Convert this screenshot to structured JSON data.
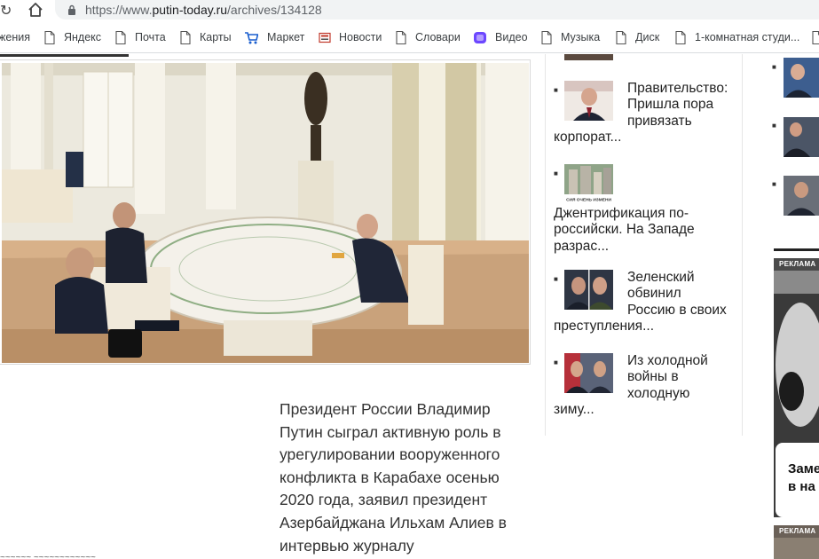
{
  "browser": {
    "url_prefix": "https://www.",
    "url_host": "putin-today.ru",
    "url_path": "/archives/134128",
    "bookmarks": [
      {
        "label": "жения",
        "icon": "none"
      },
      {
        "label": "Яндекс",
        "icon": "page-icon"
      },
      {
        "label": "Почта",
        "icon": "page-icon"
      },
      {
        "label": "Карты",
        "icon": "page-icon"
      },
      {
        "label": "Маркет",
        "icon": "cart-icon"
      },
      {
        "label": "Новости",
        "icon": "news-icon"
      },
      {
        "label": "Словари",
        "icon": "page-icon"
      },
      {
        "label": "Видео",
        "icon": "video-icon"
      },
      {
        "label": "Музыка",
        "icon": "page-icon"
      },
      {
        "label": "Диск",
        "icon": "page-icon"
      },
      {
        "label": "1-комнатная студи...",
        "icon": "page-icon"
      }
    ]
  },
  "article": {
    "lead": "Президент России Владимир Путин сыграл активную роль в урегулировании вооруженного конфликта в Карабахе осенью 2020 года, заявил президент Азербайджана Ильхам Алиев в интервью журналу",
    "bottom_cut_text": "~~~~~~ ~~~~~~~~~~~~"
  },
  "sidebar": {
    "items": [
      {
        "title": "Правительство: Пришла пора привязать корпорат..."
      },
      {
        "title": "Джентрификация по-российски. На Западе разрас...",
        "thumb_caption": "СИЯ ОЧЕНЬ ИЗМЕНИ"
      },
      {
        "title": "Зеленский обвинил Россию в своих преступления..."
      },
      {
        "title": "Из холодной войны в холодную зиму..."
      }
    ]
  },
  "ads": {
    "badge": "РЕКЛАМА",
    "badge2": "РЕКЛАМА",
    "card_text_1": "Заме",
    "card_text_2": "в на"
  },
  "colors": {
    "text": "#333333",
    "omnibox_bg": "#f1f3f4",
    "divider": "#e6e6e6"
  }
}
